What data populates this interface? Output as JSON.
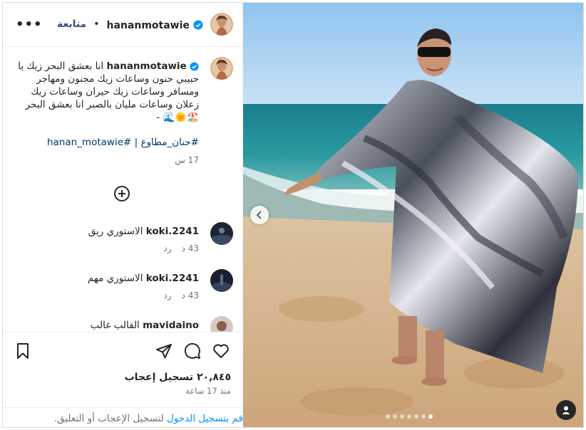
{
  "post": {
    "username": "hananmotawie",
    "follow_label": "متابعة",
    "separator": "•",
    "more_label": "•••",
    "caption_text": "انا بعشق البحر زيك يا حبيبي حنون وساعات زيك مجنون ومهاجر ومسافر وساعات زيك حيران وساعات زيك زعلان وساعات مليان بالصبر انا بعشق البحر 🏖️🌞🌊 -",
    "hashtags": [
      "#حنان_مطاوع",
      "#hanan_motawie"
    ],
    "hashtag_separator": "|",
    "time": "17 س",
    "likes": "٢٠,٨٤٥ تسجيل إعجاب",
    "since": "منذ 17 ساعة"
  },
  "comments": [
    {
      "user": "koki.2241",
      "text": "الاستوري ريق",
      "age": "43 د",
      "reply": "رد"
    },
    {
      "user": "koki.2241",
      "text": "الاستوري مهم",
      "age": "43 د",
      "reply": "رد"
    },
    {
      "user": "mavidaino",
      "text": "القالب غالب",
      "age": "",
      "reply": ""
    }
  ],
  "login_bar": {
    "link": "قم بتسجيل الدخول",
    "rest": " لتسجيل الإعجاب أو التعليق."
  },
  "carousel": {
    "count": 7,
    "active": 6
  },
  "icons": {
    "more": "more-options-icon",
    "verified": "verified-badge-icon",
    "add": "add-circle-icon",
    "like": "heart-icon",
    "comment": "comment-bubble-icon",
    "share": "share-paper-plane-icon",
    "save": "bookmark-icon",
    "prev": "chevron-left-icon",
    "tagged": "user-tag-icon"
  },
  "colors": {
    "link": "#0095f6",
    "muted": "#737373",
    "verified": "#0095f6",
    "text": "#262626"
  }
}
